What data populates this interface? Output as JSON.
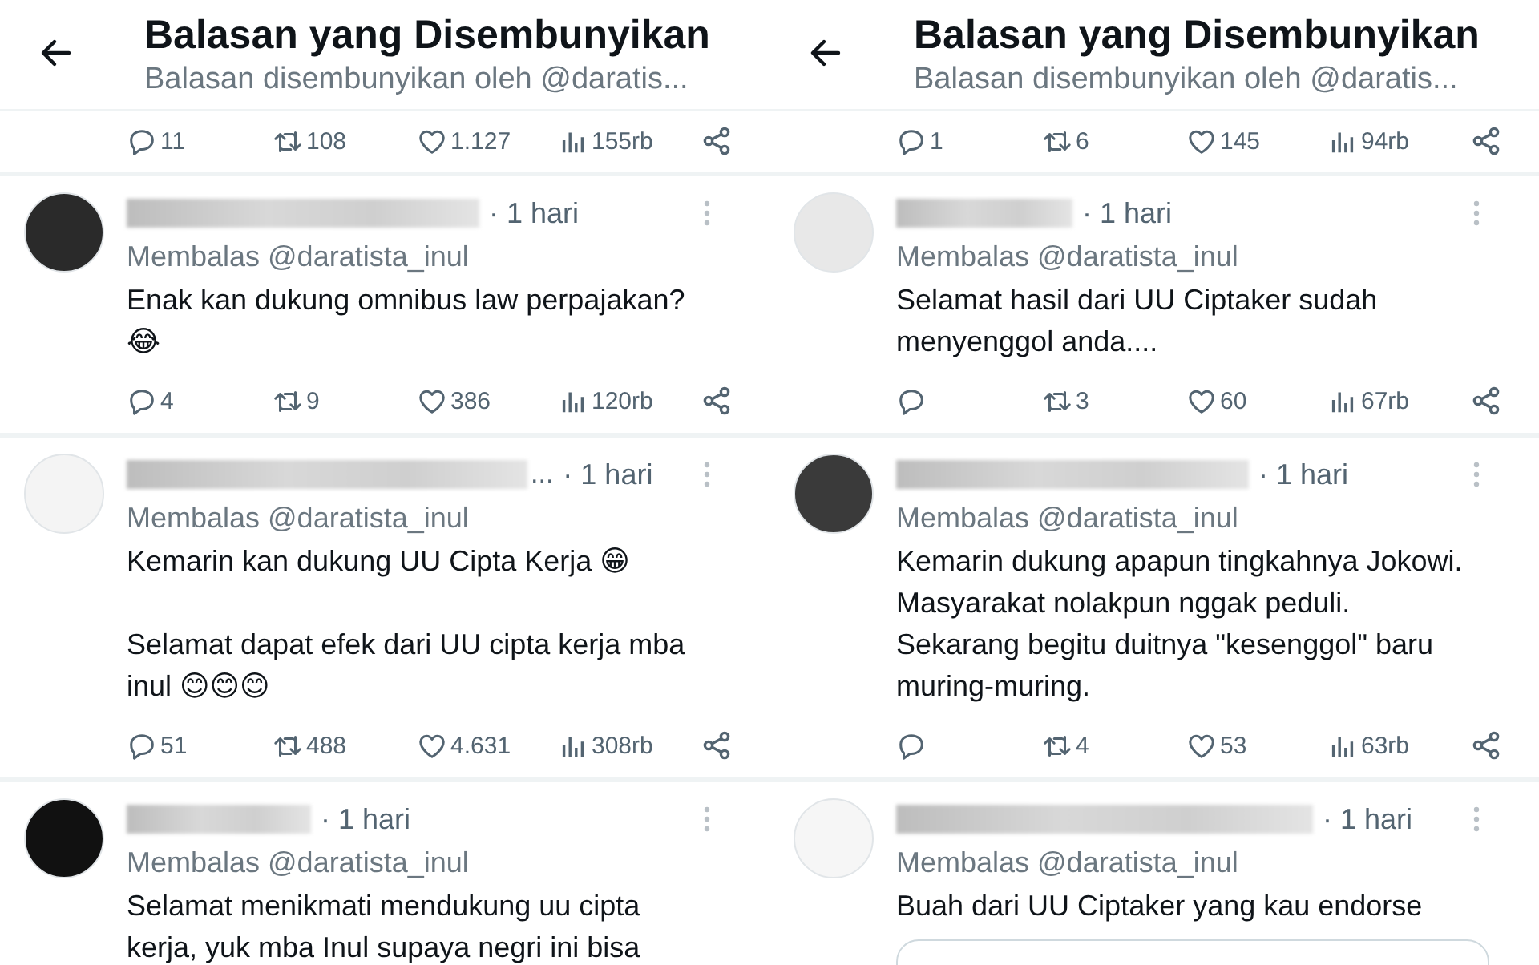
{
  "panels": [
    {
      "header": {
        "title": "Balasan yang Disembunyikan",
        "subtitle": "Balasan disembunyikan oleh @daratis..."
      },
      "top_stats": {
        "replies": "11",
        "reposts": "108",
        "likes": "1.127",
        "views": "155rb"
      },
      "tweets": [
        {
          "time": "· 1 hari",
          "reply_to": "Membalas @daratista_inul",
          "text": "Enak kan dukung omnibus law perpajakan?\n😂",
          "stats": {
            "replies": "4",
            "reposts": "9",
            "likes": "386",
            "views": "120rb"
          }
        },
        {
          "name_tail": "...",
          "time": "· 1 hari",
          "reply_to": "Membalas @daratista_inul",
          "text": "Kemarin kan dukung UU Cipta Kerja 😁\n\nSelamat dapat efek dari UU cipta kerja mba\ninul 😊😊😊",
          "stats": {
            "replies": "51",
            "reposts": "488",
            "likes": "4.631",
            "views": "308rb"
          }
        },
        {
          "time": "· 1 hari",
          "reply_to": "Membalas @daratista_inul",
          "text": "Selamat menikmati mendukung uu cipta\nkerja, yuk mba Inul supaya negri ini bisa"
        }
      ]
    },
    {
      "header": {
        "title": "Balasan yang Disembunyikan",
        "subtitle": "Balasan disembunyikan oleh @daratis..."
      },
      "top_stats": {
        "replies": "1",
        "reposts": "6",
        "likes": "145",
        "views": "94rb"
      },
      "tweets": [
        {
          "time": "· 1 hari",
          "reply_to": "Membalas @daratista_inul",
          "text": "Selamat hasil dari UU Ciptaker sudah\nmenyenggol anda....",
          "stats": {
            "reposts": "3",
            "likes": "60",
            "views": "67rb"
          }
        },
        {
          "time": "· 1 hari",
          "reply_to": "Membalas @daratista_inul",
          "text": "Kemarin dukung apapun tingkahnya Jokowi.\nMasyarakat nolakpun nggak peduli.\nSekarang begitu duitnya \"kesenggol\" baru\nmuring-muring.",
          "stats": {
            "reposts": "4",
            "likes": "53",
            "views": "63rb"
          }
        },
        {
          "time": "· 1 hari",
          "reply_to": "Membalas @daratista_inul",
          "text": "Buah dari UU Ciptaker yang kau endorse",
          "card": true
        }
      ]
    }
  ]
}
